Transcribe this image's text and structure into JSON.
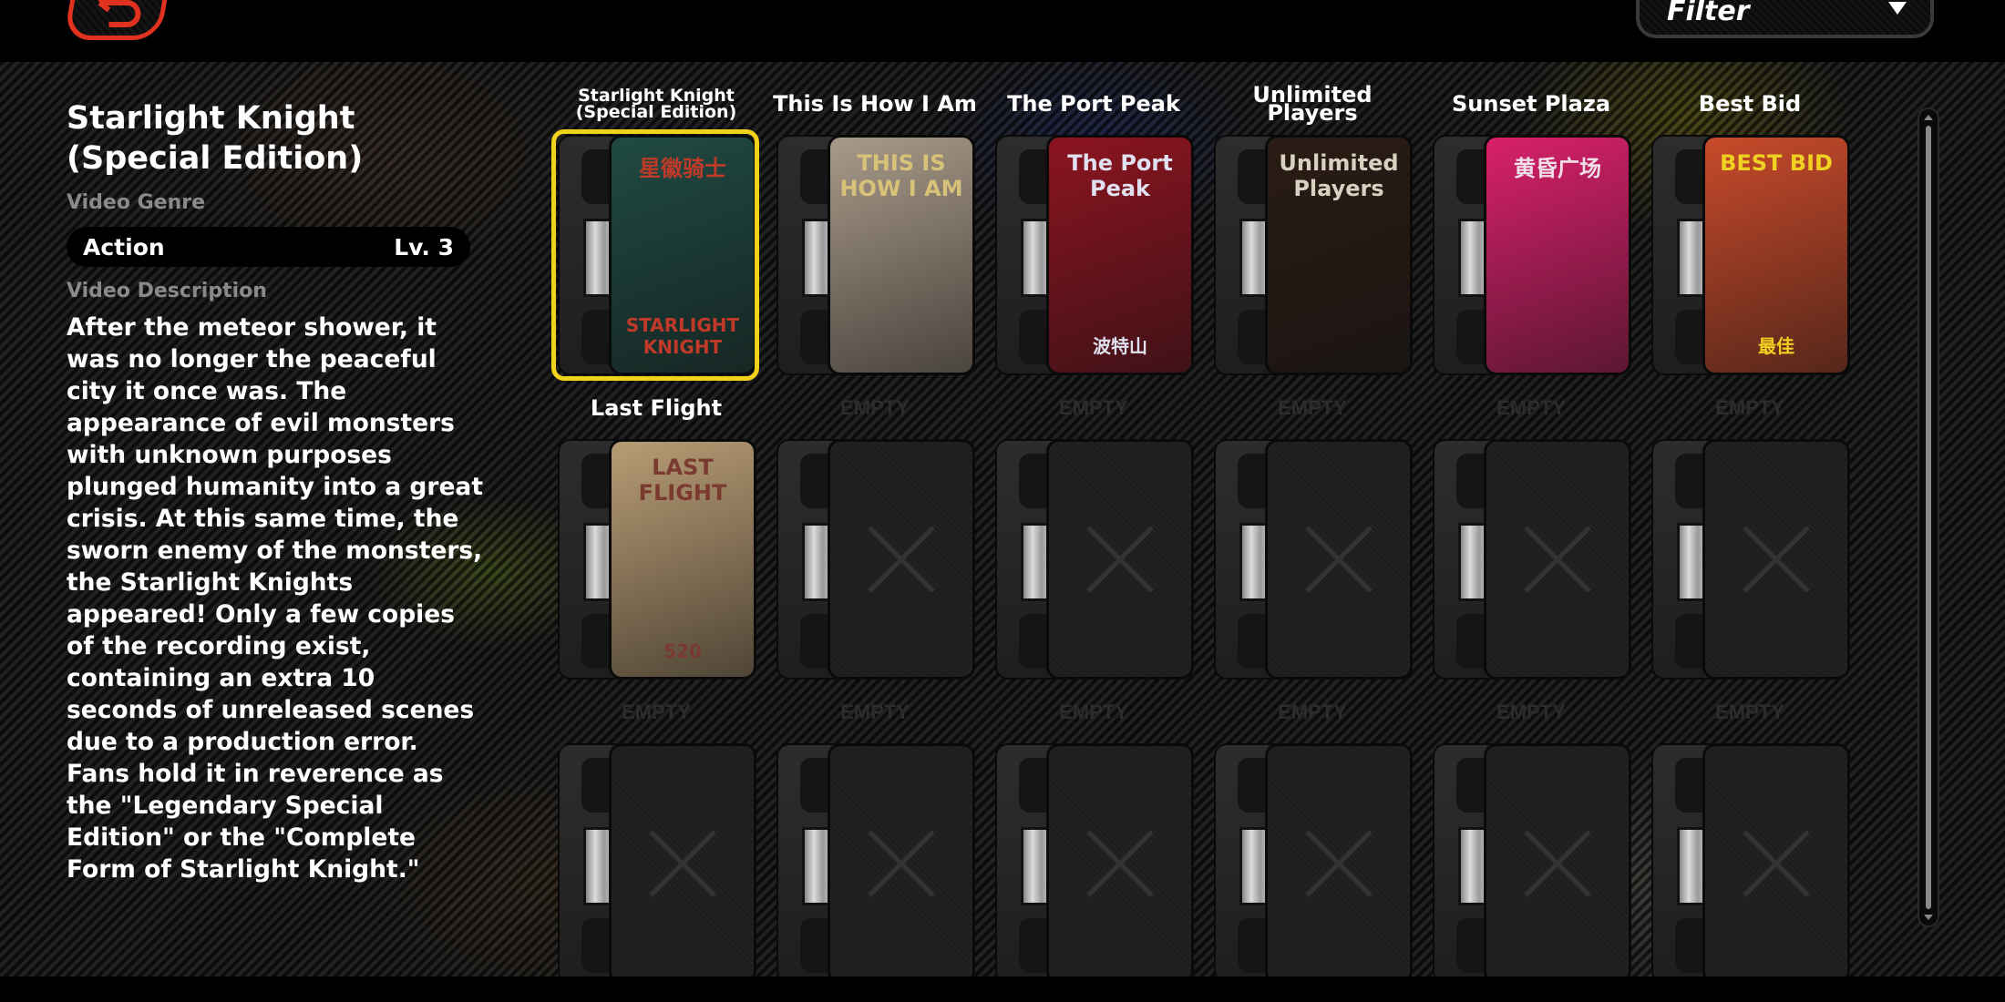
{
  "header": {
    "back_icon": "back-arrow-icon",
    "filter": {
      "label": "Filter",
      "caret_icon": "caret-down-icon"
    }
  },
  "details": {
    "title": "Starlight Knight (Special Edition)",
    "genre_label": "Video Genre",
    "genre": "Action",
    "level": "Lv. 3",
    "description_label": "Video Description",
    "description": "After the meteor shower, it was no longer the peaceful city it once was. The appearance of evil monsters with unknown purposes plunged humanity into a great crisis. At this same time, the sworn enemy of the monsters, the Starlight Knights appeared! Only a few copies of the recording exist, containing an extra 10 seconds of unreleased scenes due to a production error. Fans hold it in reverence as the \"Legendary Special Edition\" or the \"Complete Form of Starlight Knight.\""
  },
  "colors": {
    "accent_red": "#e0321e",
    "selected_yellow": "#f0d21a"
  },
  "slots": [
    {
      "title": "Starlight Knight (Special Edition)",
      "cover_text": "星徽骑士",
      "cover_subtext": "STARLIGHT KNIGHT",
      "cover_bg": "#1f4a42",
      "cover_fg": "#c03a2a",
      "selected": true,
      "empty": false
    },
    {
      "title": "This Is How I Am",
      "cover_text": "THIS IS HOW I AM",
      "cover_subtext": "",
      "cover_bg": "#a89a88",
      "cover_fg": "#d8c27a",
      "selected": false,
      "empty": false
    },
    {
      "title": "The Port Peak",
      "cover_text": "The Port Peak",
      "cover_subtext": "波特山",
      "cover_bg": "#8c1420",
      "cover_fg": "#e0e0f0",
      "selected": false,
      "empty": false
    },
    {
      "title": "Unlimited Players",
      "cover_text": "Unlimited Players",
      "cover_subtext": "",
      "cover_bg": "#2a1c14",
      "cover_fg": "#d8d0c0",
      "selected": false,
      "empty": false
    },
    {
      "title": "Sunset Plaza",
      "cover_text": "黄昏广场",
      "cover_subtext": "",
      "cover_bg": "#d8206a",
      "cover_fg": "#f0e0e8",
      "selected": false,
      "empty": false
    },
    {
      "title": "Best Bid",
      "cover_text": "BEST BID",
      "cover_subtext": "最佳",
      "cover_bg": "#c84a2a",
      "cover_fg": "#f0d020",
      "selected": false,
      "empty": false
    },
    {
      "title": "Last Flight",
      "cover_text": "LAST FLIGHT",
      "cover_subtext": "520",
      "cover_bg": "#b89c74",
      "cover_fg": "#7a3a30",
      "selected": false,
      "empty": false
    },
    {
      "title": "EMPTY",
      "empty": true
    },
    {
      "title": "EMPTY",
      "empty": true
    },
    {
      "title": "EMPTY",
      "empty": true
    },
    {
      "title": "EMPTY",
      "empty": true
    },
    {
      "title": "EMPTY",
      "empty": true
    },
    {
      "title": "EMPTY",
      "empty": true
    },
    {
      "title": "EMPTY",
      "empty": true
    },
    {
      "title": "EMPTY",
      "empty": true
    },
    {
      "title": "EMPTY",
      "empty": true
    },
    {
      "title": "EMPTY",
      "empty": true
    },
    {
      "title": "EMPTY",
      "empty": true
    }
  ],
  "scrollbar": {
    "position": 0.0,
    "up_icon": "scroll-up-icon",
    "down_icon": "scroll-down-icon"
  }
}
